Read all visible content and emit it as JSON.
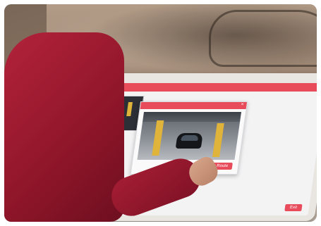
{
  "screen": {
    "brand": "",
    "time": "",
    "right_caption": "",
    "left_panel_label": "",
    "modal": {
      "title": "",
      "close": "×",
      "action_label": "New Route"
    },
    "exit_label": "Exit"
  },
  "colors": {
    "accent": "#e84c5b",
    "pillar": "#e0b43a"
  }
}
